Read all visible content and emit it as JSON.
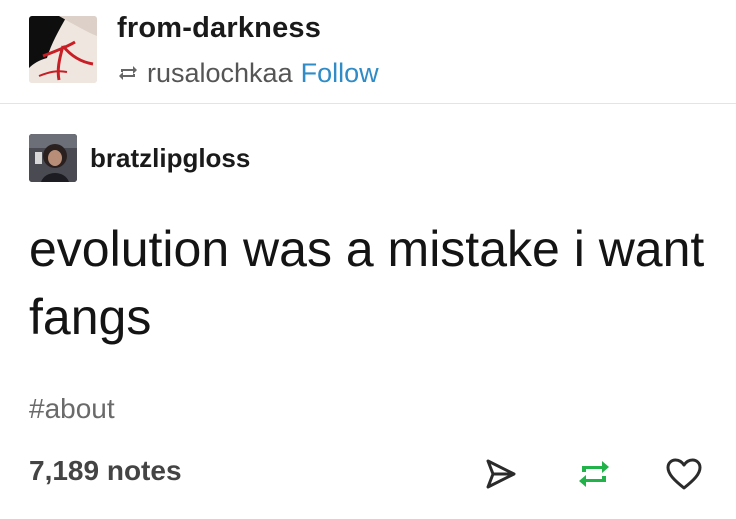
{
  "header": {
    "blog_name": "from-darkness",
    "reblogged_from": "rusalochkaa",
    "follow_label": "Follow",
    "follow_color": "#2f8cc7"
  },
  "post": {
    "author": "bratzlipgloss",
    "text": "evolution was a mistake i want fangs",
    "tag": "#about",
    "notes": "7,189 notes"
  },
  "actions": [
    {
      "icon": "share-icon"
    },
    {
      "icon": "reblog-icon",
      "color": "#21b24a"
    },
    {
      "icon": "heart-icon"
    }
  ]
}
